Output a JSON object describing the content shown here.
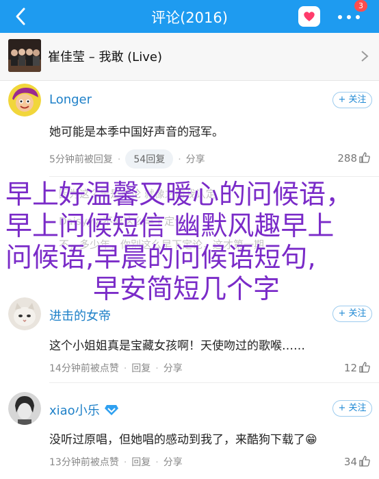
{
  "header": {
    "title": "评论(2016)",
    "badge": "3"
  },
  "song": {
    "title": "崔佳莹 – 我敢 (Live)"
  },
  "follow_label": "+ 关注",
  "comments": [
    {
      "user": "Longer",
      "text": "她可能是本季中国好声音的冠军。",
      "time": "5分钟前被回复",
      "reply": "54回复",
      "share": "分享",
      "likes": "288"
    },
    {
      "user": "进击的女帝",
      "text": "这个小姐姐真是宝藏女孩啊！天使吻过的歌喉……",
      "time": "14分钟前被点赞",
      "reply": "回复",
      "share": "分享",
      "likes": "12"
    },
    {
      "user": "xiao小乐",
      "text": "没听过原唱，但她唱的感动到我了，来酷狗下载了😁",
      "time": "13分钟前被点赞",
      "reply": "回复",
      "share": "分享",
      "likes": "34"
    }
  ],
  "overlay": {
    "line1": "早上好温馨又暖心的问候语，",
    "line2": "早上问候短信 幽默风趣早上",
    "line3": "问候语,早晨的问候语短句,",
    "line4": "早安简短几个字"
  },
  "colors": {
    "header": "#1e9bf0",
    "link": "#1e80c8",
    "overlay": "#7a2bc8"
  }
}
